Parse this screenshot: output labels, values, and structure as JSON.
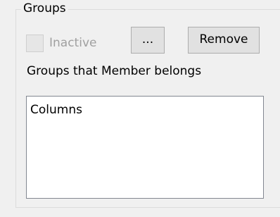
{
  "groups_panel": {
    "title": "Groups",
    "inactive_checkbox": {
      "label": "Inactive",
      "checked": false,
      "enabled": false
    },
    "browse_button_label": "...",
    "remove_button_label": "Remove",
    "list_label": "Groups that Member belongs",
    "list_items": [
      "Columns"
    ]
  }
}
